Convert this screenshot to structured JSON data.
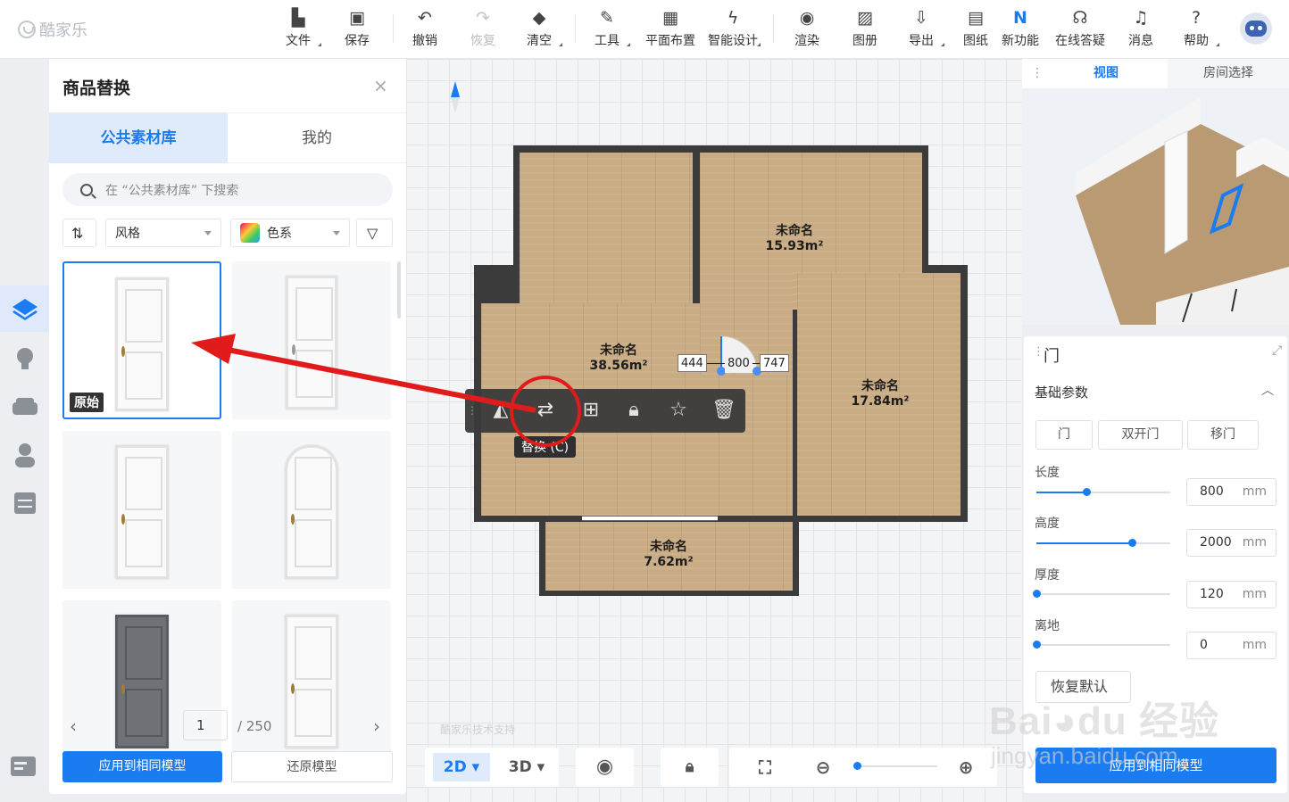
{
  "app": {
    "name": "酷家乐"
  },
  "toolbar": {
    "items": [
      {
        "label": "文件",
        "icon": "file-icon"
      },
      {
        "label": "保存",
        "icon": "save-icon"
      },
      {
        "label": "撤销",
        "icon": "undo-icon"
      },
      {
        "label": "恢复",
        "icon": "redo-icon"
      },
      {
        "label": "清空",
        "icon": "eraser-icon"
      },
      {
        "label": "工具",
        "icon": "wrench-icon"
      },
      {
        "label": "平面布置",
        "icon": "layout-icon"
      },
      {
        "label": "智能设计",
        "icon": "lightning-icon"
      },
      {
        "label": "渲染",
        "icon": "render-icon"
      },
      {
        "label": "图册",
        "icon": "gallery-icon"
      },
      {
        "label": "导出",
        "icon": "export-icon"
      },
      {
        "label": "图纸",
        "icon": "drawing-icon"
      },
      {
        "label": "新功能",
        "icon": "new-feature-icon"
      },
      {
        "label": "在线答疑",
        "icon": "headset-icon"
      },
      {
        "label": "消息",
        "icon": "bell-icon"
      },
      {
        "label": "帮助",
        "icon": "help-icon"
      }
    ]
  },
  "panel": {
    "title": "商品替换",
    "tabs": [
      "公共素材库",
      "我的"
    ],
    "search_placeholder": "在 “公共素材库” 下搜索",
    "filter_style": "风格",
    "filter_color": "色系",
    "original_tag": "原始",
    "page_current": "1",
    "page_total": "/ 250",
    "apply_button": "应用到相同模型",
    "restore_button": "还原模型"
  },
  "canvas": {
    "rooms": [
      {
        "name": "未命名",
        "area": "15.93m²"
      },
      {
        "name": "未命名",
        "area": "38.56m²"
      },
      {
        "name": "未命名",
        "area": "17.84m²"
      },
      {
        "name": "未命名",
        "area": "7.62m²"
      }
    ],
    "dims": {
      "left": "444",
      "mid": "800",
      "right": "747"
    },
    "tooltip": "替换 (C)",
    "watermark": "酷家乐技术支持",
    "view_2d": "2D",
    "view_3d": "3D",
    "zoom_level": 0.02
  },
  "right": {
    "tabs": [
      "视图",
      "房间选择"
    ],
    "props_title": "门",
    "section": "基础参数",
    "types": [
      "门",
      "双开门",
      "移门"
    ],
    "params": [
      {
        "label": "长度",
        "value": "800",
        "unit": "mm",
        "level": 0.37
      },
      {
        "label": "高度",
        "value": "2000",
        "unit": "mm",
        "level": 0.71
      },
      {
        "label": "厚度",
        "value": "120",
        "unit": "mm",
        "level": 0.0
      },
      {
        "label": "离地",
        "value": "0",
        "unit": "mm",
        "level": 0.0
      }
    ],
    "reset_button": "恢复默认",
    "apply_button": "应用到相同模型"
  },
  "colors": {
    "accent": "#1a7cf0",
    "annotation": "#e11b1b"
  }
}
